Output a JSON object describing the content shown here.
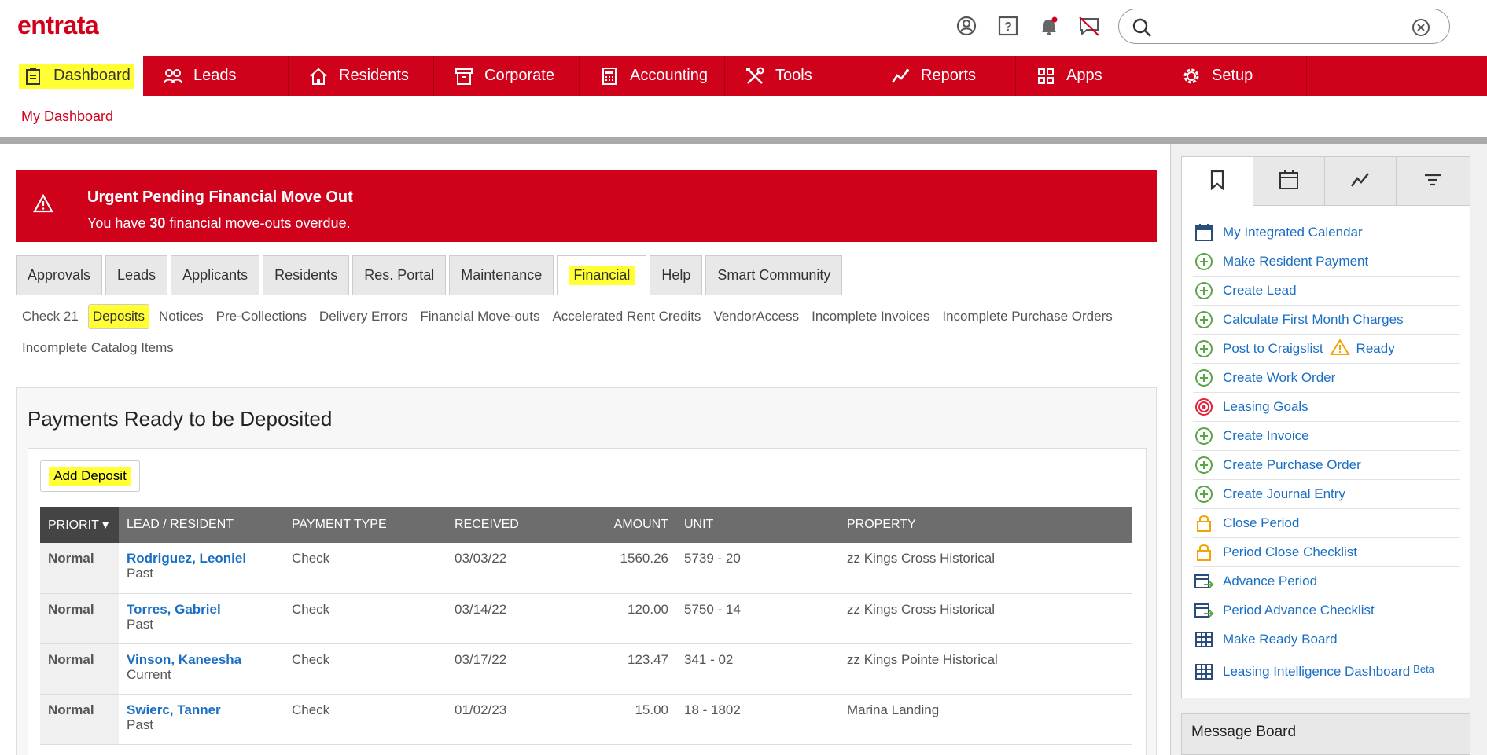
{
  "brand": {
    "logo": "entrata",
    "accent": "#d0021b",
    "highlight": "#ffff33",
    "link": "#1a6fc4"
  },
  "search": {
    "placeholder": "",
    "value": ""
  },
  "nav": {
    "items": [
      {
        "label": "Dashboard",
        "icon": "clipboard-icon"
      },
      {
        "label": "Leads",
        "icon": "people-icon"
      },
      {
        "label": "Residents",
        "icon": "house-icon"
      },
      {
        "label": "Corporate",
        "icon": "archive-icon"
      },
      {
        "label": "Accounting",
        "icon": "calculator-icon"
      },
      {
        "label": "Tools",
        "icon": "tools-icon"
      },
      {
        "label": "Reports",
        "icon": "trend-icon"
      },
      {
        "label": "Apps",
        "icon": "apps-icon"
      },
      {
        "label": "Setup",
        "icon": "gear-icon"
      }
    ],
    "sub": "My Dashboard"
  },
  "alert": {
    "title": "Urgent Pending Financial Move Out",
    "msg_prefix": "You have ",
    "count": "30",
    "msg_suffix": " financial move-outs overdue."
  },
  "tabs": [
    "Approvals",
    "Leads",
    "Applicants",
    "Residents",
    "Res. Portal",
    "Maintenance",
    "Financial",
    "Help",
    "Smart Community"
  ],
  "subtabs": [
    "Check 21",
    "Deposits",
    "Notices",
    "Pre-Collections",
    "Delivery Errors",
    "Financial Move-outs",
    "Accelerated Rent Credits",
    "VendorAccess",
    "Incomplete Invoices",
    "Incomplete Purchase Orders",
    "Incomplete Catalog Items"
  ],
  "payments": {
    "title": "Payments Ready to be Deposited",
    "add_label": "Add Deposit",
    "columns": [
      "PRIORIT",
      "LEAD / RESIDENT",
      "PAYMENT TYPE",
      "RECEIVED",
      "AMOUNT",
      "UNIT",
      "PROPERTY"
    ],
    "rows": [
      {
        "priority": "Normal",
        "name": "Rodriguez, Leoniel",
        "status": "Past",
        "type": "Check",
        "received": "03/03/22",
        "amount": "1560.26",
        "unit": "5739 - 20",
        "property": "zz Kings Cross Historical"
      },
      {
        "priority": "Normal",
        "name": "Torres, Gabriel",
        "status": "Past",
        "type": "Check",
        "received": "03/14/22",
        "amount": "120.00",
        "unit": "5750 - 14",
        "property": "zz Kings Cross Historical"
      },
      {
        "priority": "Normal",
        "name": "Vinson, Kaneesha",
        "status": "Current",
        "type": "Check",
        "received": "03/17/22",
        "amount": "123.47",
        "unit": "341 - 02",
        "property": "zz Kings Pointe Historical"
      },
      {
        "priority": "Normal",
        "name": "Swierc, Tanner",
        "status": "Past",
        "type": "Check",
        "received": "01/02/23",
        "amount": "15.00",
        "unit": "18 - 1802",
        "property": "Marina Landing"
      }
    ]
  },
  "side": {
    "items": [
      {
        "label": "My Integrated Calendar",
        "icon": "calendar-icon"
      },
      {
        "label": "Make Resident Payment",
        "icon": "plus-circle-icon"
      },
      {
        "label": "Create Lead",
        "icon": "plus-circle-icon"
      },
      {
        "label": "Calculate First Month Charges",
        "icon": "plus-circle-icon"
      },
      {
        "label": "Post to Craigslist",
        "icon": "plus-circle-icon",
        "tag": "Ready"
      },
      {
        "label": "Create Work Order",
        "icon": "plus-circle-icon"
      },
      {
        "label": "Leasing Goals",
        "icon": "target-icon"
      },
      {
        "label": "Create Invoice",
        "icon": "plus-circle-icon"
      },
      {
        "label": "Create Purchase Order",
        "icon": "plus-circle-icon"
      },
      {
        "label": "Create Journal Entry",
        "icon": "plus-circle-icon"
      },
      {
        "label": "Close Period",
        "icon": "lock-icon"
      },
      {
        "label": "Period Close Checklist",
        "icon": "lock-icon"
      },
      {
        "label": "Advance Period",
        "icon": "calendar-arrow-icon"
      },
      {
        "label": "Period Advance Checklist",
        "icon": "calendar-arrow-icon"
      },
      {
        "label": "Make Ready Board",
        "icon": "grid-icon"
      },
      {
        "label": "Leasing Intelligence Dashboard",
        "icon": "grid-icon",
        "sup": "Beta"
      }
    ],
    "message_board": "Message Board"
  }
}
